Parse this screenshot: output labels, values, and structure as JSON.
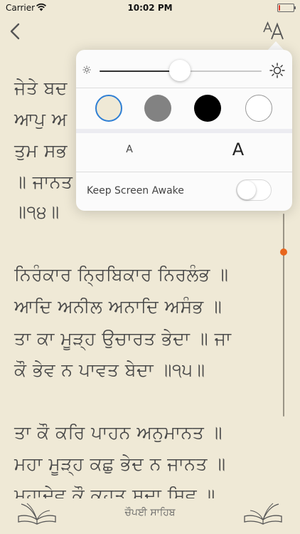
{
  "status_bar": {
    "carrier": "Carrier",
    "time": "10:02 PM",
    "battery_level": 0.1,
    "battery_color": "#e0392b"
  },
  "nav": {
    "back_icon": "chevron-left-icon",
    "font_icon": "text-size-icon"
  },
  "gurbani": {
    "lines": [
      "ਜੇਤੇ ਬਦ",
      "ਆਪੁ ਅ",
      "ਤੁਮ ਸਭ",
      "॥ ਜਾਨਤ",
      "॥੧੪॥",
      "ਨਿਰੰਕਾਰ ਨ੍ਰਿਬਿਕਾਰ ਨਿਰਲੰਭ ॥",
      "ਆਦਿ ਅਨੀਲ ਅਨਾਦਿ ਅਸੰਭ ॥",
      "ਤਾ ਕਾ ਮੂੜ੍ਹ ਉਚਾਰਤ ਭੇਦਾ ॥ ਜਾ",
      "ਕੌ ਭੇਵ ਨ ਪਾਵਤ ਬੇਦਾ ॥੧੫॥",
      "ਤਾ ਕੌ ਕਰਿ ਪਾਹਨ ਅਨੁਮਾਨਤ ॥",
      "ਮਹਾ ਮੂੜ੍ਹ ਕਛੁ ਭੇਦ ਨ ਜਾਨਤ ॥",
      "ਮਹਾਦੇਵ ਕੌ ਕਹਤ ਸਦਾ ਸਿਵ ॥"
    ]
  },
  "footer": {
    "title": "ਚੌਪਈ ਸਾਹਿਬ",
    "left_icon": "open-book-icon",
    "right_icon": "open-book-icon"
  },
  "settings_popover": {
    "brightness": {
      "level": 0.53,
      "min_icon": "sun-small-icon",
      "max_icon": "sun-large-icon"
    },
    "themes": [
      {
        "name": "cream",
        "color": "#efe9d6",
        "selected": true
      },
      {
        "name": "gray",
        "color": "#828282",
        "selected": false
      },
      {
        "name": "black",
        "color": "#000000",
        "selected": false
      },
      {
        "name": "white",
        "color": "#ffffff",
        "selected": false
      }
    ],
    "font_size": {
      "decrease_label": "A",
      "increase_label": "A"
    },
    "keep_awake": {
      "label": "Keep Screen Awake",
      "enabled": false
    }
  },
  "scroll": {
    "position": 0.17,
    "indicator_color": "#e8661c"
  }
}
